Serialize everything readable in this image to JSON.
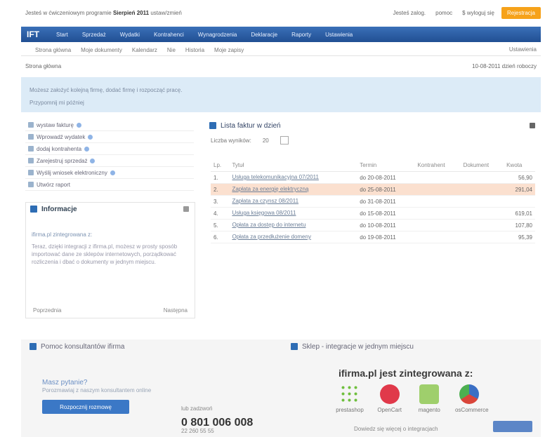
{
  "topbar": {
    "left_text": "Jesteś w ćwiczeniowym programie",
    "left_bold": "Sierpień 2011",
    "left_extra": "ustaw/zmień",
    "right_items": [
      "Jesteś zalog.",
      "pomoc",
      "$ wyloguj się"
    ],
    "cta_label": "Rejestracja"
  },
  "navbar": {
    "brand": "IFT",
    "items": [
      "Start",
      "Sprzedaż",
      "Wydatki",
      "Kontrahenci",
      "Wynagrodzenia",
      "Deklaracje",
      "Raporty",
      "Ustawienia"
    ]
  },
  "subnav": {
    "items": [
      "Strona główna",
      "Moje dokumenty",
      "Kalendarz",
      "Nie",
      "Historia",
      "Moje zapisy"
    ],
    "right": "Ustawienia"
  },
  "breadcrumb": {
    "left": "Strona główna",
    "right": "10-08-2011  dzień roboczy"
  },
  "info_bar": {
    "line1": "Możesz założyć kolejną firmę, dodać firmę i rozpocząć pracę.",
    "line2": "Przypomnij mi później"
  },
  "sidebar": {
    "items": [
      "wystaw fakturę",
      "Wprowadź wydatek",
      "dodaj kontrahenta",
      "Zarejestruj sprzedaż",
      "Wyślij wniosek elektroniczny",
      "Utwórz raport"
    ],
    "info": {
      "title": "Informacje",
      "subtitle": "ifirma.pl zintegrowana z:",
      "body": "Teraz, dzięki integracji z ifirma.pl, możesz w prosty sposób importować dane ze sklepów internetowych, porządkować rozliczenia i dbać o dokumenty w jednym miejscu.",
      "footer_left": "Poprzednia",
      "footer_right": "Następna"
    }
  },
  "main": {
    "title": "Lista faktur w dzień",
    "filter_label": "Liczba wyników:",
    "filter_value": "20",
    "columns": [
      "Lp.",
      "Tytuł",
      "Termin",
      "Kontrahent",
      "Dokument",
      "Kwota"
    ],
    "rows": [
      {
        "lp": "1.",
        "title": "Usługa telekomunikacyjna 07/2011",
        "term": "do 20-08-2011",
        "contractor": "",
        "doc": "",
        "amount": "56,90",
        "hl": false
      },
      {
        "lp": "2.",
        "title": "Zapłata za energię elektryczną",
        "term": "do 25-08-2011",
        "contractor": "",
        "doc": "",
        "amount": "291,04",
        "hl": true
      },
      {
        "lp": "3.",
        "title": "Zapłata za czynsz 08/2011",
        "term": "do 31-08-2011",
        "contractor": "",
        "doc": "",
        "amount": "",
        "hl": false
      },
      {
        "lp": "4.",
        "title": "Usługa księgowa 08/2011",
        "term": "do 15-08-2011",
        "contractor": "",
        "doc": "",
        "amount": "619,01",
        "hl": false
      },
      {
        "lp": "5.",
        "title": "Opłata za dostęp do internetu",
        "term": "do 10-08-2011",
        "contractor": "",
        "doc": "",
        "amount": "107,80",
        "hl": false
      },
      {
        "lp": "6.",
        "title": "Opłata za przedłużenie domeny",
        "term": "do 19-08-2011",
        "contractor": "",
        "doc": "",
        "amount": "95,39",
        "hl": false
      }
    ]
  },
  "panel_left": {
    "title": "Pomoc konsultantów ifirma",
    "question": "Masz pytanie?",
    "desc": "Porozmawiaj z naszym konsultantem online",
    "button": "Rozpocznij rozmowę",
    "or_call": "lub zadzwoń",
    "phone": "0 801 006 008",
    "phone_sub": "22 260 55 55"
  },
  "panel_right": {
    "title": "Sklep - integracje w jednym miejscu",
    "headline": "ifirma.pl jest zintegrowana z:",
    "logos": [
      "prestashop",
      "OpenCart",
      "magento",
      "osCommerce"
    ],
    "bottom_text": "Dowiedz się więcej o integracjach"
  },
  "colors": {
    "navbar": "#2a5ea9",
    "accent_orange": "#f6a21a",
    "info_bg": "#dcebf7",
    "highlight_row": "#fbe0cf"
  }
}
